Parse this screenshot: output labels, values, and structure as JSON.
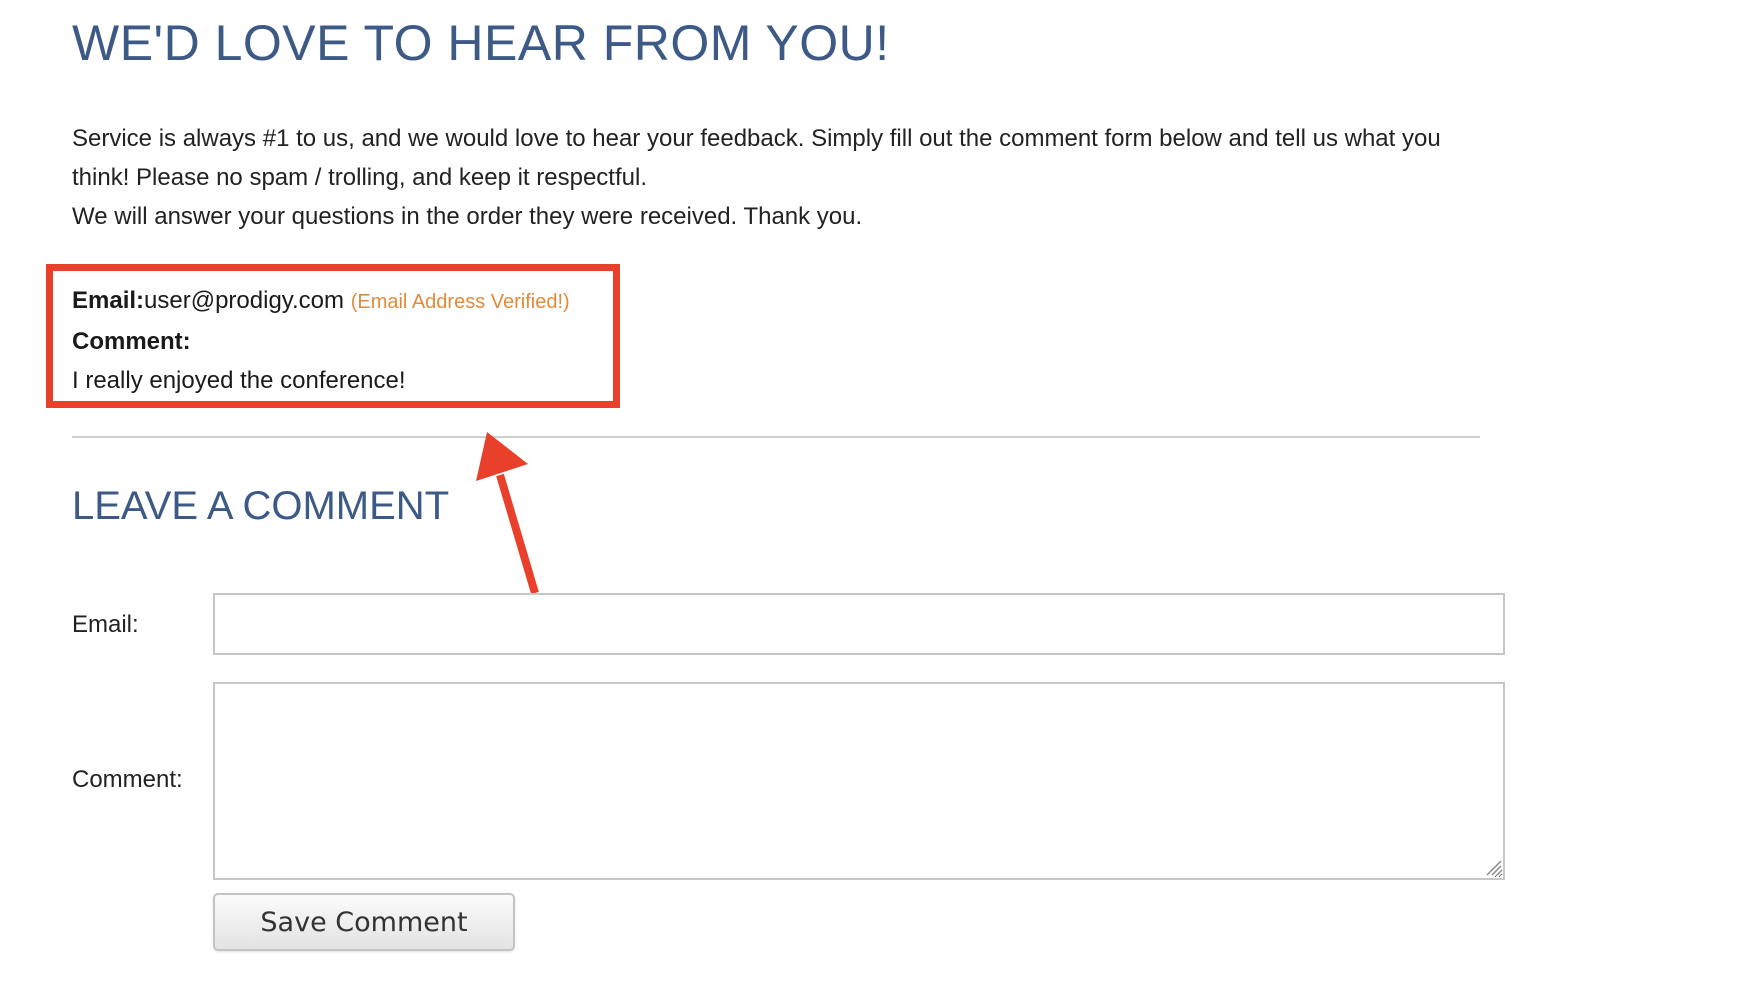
{
  "page": {
    "title": "WE'D LOVE TO HEAR FROM YOU!",
    "intro_line1": "Service is always #1 to us, and we would love to hear your feedback. Simply fill out the comment form below and tell us what you think! Please no spam / trolling, and keep it respectful.",
    "intro_line2": "We will answer your questions in the order they were received. Thank you."
  },
  "posted_comment": {
    "email_label": "Email:",
    "email_value": "user@prodigy.com",
    "verified_note": "(Email Address Verified!)",
    "comment_label": "Comment:",
    "comment_text": "I really enjoyed the conference!"
  },
  "form": {
    "section_title": "LEAVE A COMMENT",
    "email_label": "Email:",
    "email_value": "",
    "comment_label": "Comment:",
    "comment_value": "",
    "save_label": "Save Comment"
  },
  "colors": {
    "heading": "#3d5a87",
    "highlight": "#e8402b",
    "verified": "#e58a3a"
  }
}
